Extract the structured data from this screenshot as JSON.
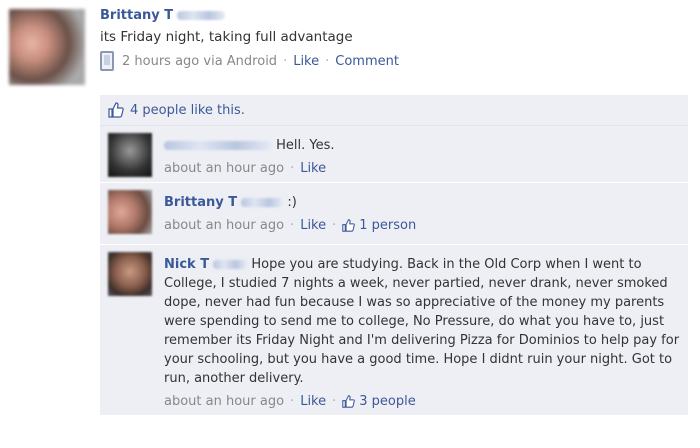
{
  "post": {
    "author": "Brittany T",
    "text": "its Friday night, taking full advantage",
    "time": "2 hours ago via Android",
    "like_label": "Like",
    "comment_label": "Comment"
  },
  "likes": {
    "text": "4 people like this."
  },
  "comments": [
    {
      "name": "",
      "text": "Hell. Yes.",
      "time": "about an hour ago",
      "like_label": "Like",
      "like_count": ""
    },
    {
      "name": "Brittany T",
      "text": ":)",
      "time": "about an hour ago",
      "like_label": "Like",
      "like_count": "1 person"
    },
    {
      "name": "Nick T",
      "text": "Hope you are studying. Back in the Old Corp when I went to College, I studied 7 nights a week, never partied, never drank, never smoked dope, never had fun because I was so appreciative of the money my parents were spending to send me to college, No Pressure, do what you have to, just remember its Friday Night and I'm delivering Pizza for Dominios to help pay for your schooling, but you have a good time. Hope I didnt ruin your night. Got to run, another delivery.",
      "time": "about an hour ago",
      "like_label": "Like",
      "like_count": "3 people"
    }
  ],
  "colors": {
    "link": "#3b5998",
    "feedback_bg": "#edeff4",
    "meta": "#888888"
  }
}
